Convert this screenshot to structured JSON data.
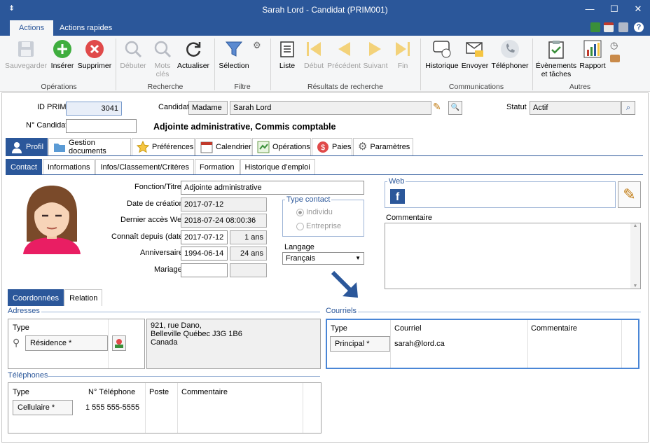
{
  "window": {
    "title": "Sarah Lord - Candidat (PRIM001)"
  },
  "ribbon_tabs": [
    "Actions",
    "Actions rapides"
  ],
  "ribbon": {
    "save": "Sauvegarder",
    "insert": "Insérer",
    "delete": "Supprimer",
    "start": "Débuter",
    "keywords": "Mots clés",
    "refresh": "Actualiser",
    "selection": "Sélection",
    "list": "Liste",
    "first": "Début",
    "prev": "Précédent",
    "next": "Suivant",
    "last": "Fin",
    "history": "Historique",
    "send": "Envoyer",
    "phone": "Téléphoner",
    "events": "Évènements et tâches",
    "report": "Rapport",
    "groups": {
      "operations": "Opérations",
      "search": "Recherche",
      "filter": "Filtre",
      "results": "Résultats de recherche",
      "communications": "Communications",
      "others": "Autres"
    }
  },
  "header": {
    "id_label": "ID PRIM",
    "id_value": "3041",
    "candidat_label": "Candidat",
    "salutation": "Madame",
    "name": "Sarah Lord",
    "status_label": "Statut",
    "status": "Actif",
    "num_label": "N° Candidat",
    "num_value": "",
    "job_title": "Adjointe administrative, Commis comptable"
  },
  "main_tabs": [
    "Profil",
    "Gestion documents",
    "Préférences",
    "Calendrier",
    "Opérations",
    "Paies",
    "Paramètres"
  ],
  "sub_tabs": [
    "Contact",
    "Informations",
    "Infos/Classement/Critères",
    "Formation",
    "Historique d'emploi"
  ],
  "profile": {
    "fonction_label": "Fonction/Titre",
    "fonction": "Adjointe administrative",
    "creation_label": "Date de création",
    "creation": "2017-07-12",
    "web_access_label": "Dernier accès Web",
    "web_access": "2018-07-24 08:00:36",
    "known_label": "Connaît depuis (date)",
    "known": "2017-07-12",
    "known_years": "1 ans",
    "birthday_label": "Anniversaire",
    "birthday": "1994-06-14",
    "age": "24 ans",
    "marriage_label": "Mariage",
    "marriage": "",
    "marriage_years": "",
    "contact_type_title": "Type contact",
    "contact_individual": "Individu",
    "contact_enterprise": "Entreprise",
    "language_label": "Langage",
    "language": "Français",
    "web_title": "Web",
    "comment_label": "Commentaire"
  },
  "coord_tabs": [
    "Coordonnées",
    "Relation"
  ],
  "addresses": {
    "title": "Adresses",
    "type_header": "Type",
    "type_value": "Résidence *",
    "line1": "921, rue Dano,",
    "line2": "Belleville Québec J3G 1B6",
    "line3": "Canada"
  },
  "emails": {
    "title": "Courriels",
    "headers": [
      "Type",
      "Courriel",
      "Commentaire"
    ],
    "rows": [
      {
        "type": "Principal *",
        "email": "sarah@lord.ca",
        "comment": ""
      }
    ]
  },
  "phones": {
    "title": "Téléphones",
    "headers": [
      "Type",
      "N° Téléphone",
      "Poste",
      "Commentaire"
    ],
    "rows": [
      {
        "type": "Cellulaire *",
        "number": "1 555 555-5555",
        "ext": "",
        "comment": ""
      }
    ]
  },
  "colors": {
    "accent": "#2b579a"
  }
}
